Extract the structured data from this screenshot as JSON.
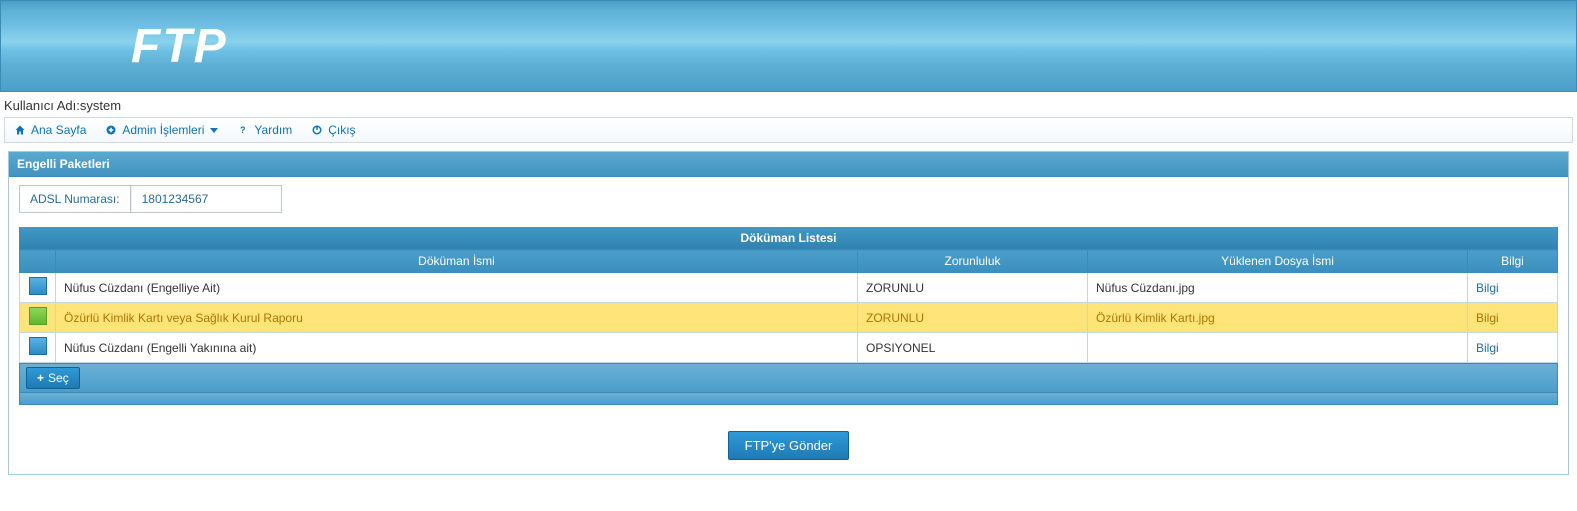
{
  "banner": {
    "title": "FTP"
  },
  "user": {
    "label_prefix": "Kullanıcı Adı:",
    "name": "system"
  },
  "menu": {
    "home": "Ana Sayfa",
    "admin": "Admin İşlemleri",
    "help": "Yardım",
    "exit": "Çıkış"
  },
  "panel": {
    "title": "Engelli Paketleri",
    "adsl_label": "ADSL Numarası:",
    "adsl_value": "1801234567"
  },
  "table": {
    "caption": "Döküman Listesi",
    "headers": {
      "name": "Döküman İsmi",
      "required": "Zorunluluk",
      "uploaded": "Yüklenen Dosya İsmi",
      "info": "Bilgi"
    },
    "rows": [
      {
        "name": "Nüfus Cüzdanı (Engelliye Ait)",
        "required": "ZORUNLU",
        "uploaded": "Nüfus Cüzdanı.jpg",
        "info": "Bilgi",
        "selected": false
      },
      {
        "name": "Özürlü Kimlik Kartı veya Sağlık Kurul Raporu",
        "required": "ZORUNLU",
        "uploaded": "Özürlü Kimlik Kartı.jpg",
        "info": "Bilgi",
        "selected": true
      },
      {
        "name": "Nüfus Cüzdanı (Engelli Yakınına ait)",
        "required": "OPSIYONEL",
        "uploaded": "",
        "info": "Bilgi",
        "selected": false
      }
    ],
    "select_button": "Seç"
  },
  "send_button": "FTP'ye Gönder"
}
